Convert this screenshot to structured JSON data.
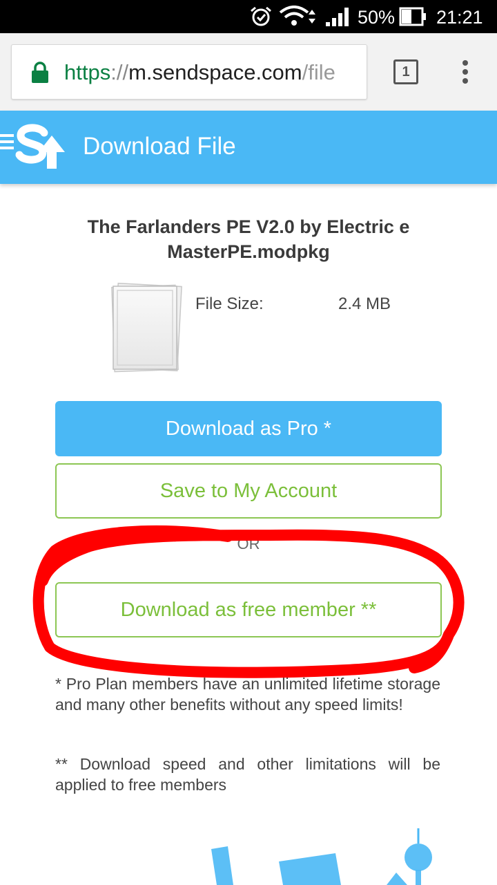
{
  "status_bar": {
    "battery_percent": "50%",
    "time": "21:21",
    "icons": [
      "alarm-icon",
      "wifi-icon",
      "signal-icon",
      "battery-icon"
    ]
  },
  "browser": {
    "url_scheme": "https",
    "url_separator": "://",
    "url_host": "m.sendspace.com",
    "url_path": "/file",
    "tab_count": "1",
    "icons": [
      "lock-icon",
      "tab-switcher-icon",
      "overflow-menu-icon"
    ]
  },
  "header": {
    "title": "Download File",
    "icons": [
      "hamburger-menu-icon",
      "sendspace-logo"
    ],
    "background_color": "#4ab8f5"
  },
  "file": {
    "name": "The Farlanders PE V2.0 by Electric e MasterPE.modpkg",
    "size_label": "File Size:",
    "size_value": "2.4 MB",
    "icons": [
      "file-thumbnail-icon"
    ]
  },
  "actions": {
    "download_pro": "Download as Pro *",
    "save_account": "Save to My Account",
    "or_text": "OR",
    "download_free": "Download as free member **"
  },
  "notes": {
    "pro": "* Pro Plan members have an unlimited lifetime storage and many other benefits without any speed limits!",
    "free": "** Download speed and other limitations will be applied to free members"
  },
  "colors": {
    "accent_blue": "#4ab8f5",
    "accent_green": "#7bbf3a",
    "annotation_red": "#ff0000"
  }
}
